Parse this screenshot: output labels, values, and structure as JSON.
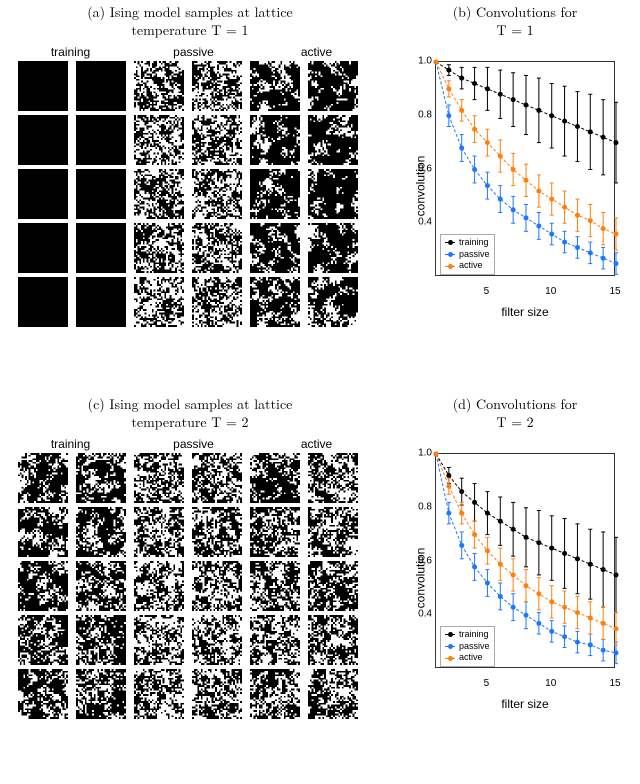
{
  "panels": {
    "a": {
      "caption_prefix": "(a) Ising model samples at lattice",
      "caption_line2": "temperature T = 1",
      "columns": [
        "training",
        "passive",
        "active"
      ]
    },
    "b": {
      "caption_prefix": "(b) Convolutions for",
      "caption_line2": "T = 1"
    },
    "c": {
      "caption_prefix": "(c) Ising model samples at lattice",
      "caption_line2": "temperature T = 2",
      "columns": [
        "training",
        "passive",
        "active"
      ]
    },
    "d": {
      "caption_prefix": "(d) Convolutions for",
      "caption_line2": "T = 2"
    }
  },
  "chart_data": [
    {
      "panel": "b",
      "type": "line",
      "title": "Convolutions for T = 1",
      "xlabel": "filter size",
      "ylabel": "convolution",
      "xlim": [
        1,
        15
      ],
      "ylim": [
        0.2,
        1.0
      ],
      "xticks": [
        5,
        10,
        15
      ],
      "yticks": [
        0.4,
        0.6,
        0.8,
        1.0
      ],
      "x": [
        1,
        2,
        3,
        4,
        5,
        6,
        7,
        8,
        9,
        10,
        11,
        12,
        13,
        14,
        15
      ],
      "series": [
        {
          "name": "training",
          "color": "#000000",
          "values": [
            1.0,
            0.97,
            0.94,
            0.92,
            0.9,
            0.88,
            0.86,
            0.84,
            0.82,
            0.8,
            0.78,
            0.76,
            0.74,
            0.72,
            0.7
          ],
          "err": [
            0,
            0.02,
            0.04,
            0.06,
            0.08,
            0.09,
            0.1,
            0.11,
            0.12,
            0.12,
            0.13,
            0.13,
            0.14,
            0.14,
            0.15
          ]
        },
        {
          "name": "passive",
          "color": "#1f77ff",
          "values": [
            1.0,
            0.8,
            0.68,
            0.6,
            0.54,
            0.49,
            0.45,
            0.42,
            0.39,
            0.36,
            0.33,
            0.31,
            0.29,
            0.27,
            0.25
          ],
          "err": [
            0,
            0.04,
            0.05,
            0.05,
            0.05,
            0.05,
            0.05,
            0.05,
            0.05,
            0.04,
            0.04,
            0.04,
            0.04,
            0.04,
            0.04
          ]
        },
        {
          "name": "active",
          "color": "#ff7f0e",
          "values": [
            1.0,
            0.9,
            0.82,
            0.75,
            0.7,
            0.65,
            0.6,
            0.56,
            0.52,
            0.49,
            0.46,
            0.43,
            0.41,
            0.38,
            0.36
          ],
          "err": [
            0,
            0.03,
            0.04,
            0.05,
            0.05,
            0.06,
            0.06,
            0.06,
            0.06,
            0.06,
            0.06,
            0.06,
            0.06,
            0.06,
            0.06
          ]
        }
      ],
      "legend_position": "lower left"
    },
    {
      "panel": "d",
      "type": "line",
      "title": "Convolutions for T = 2",
      "xlabel": "filter size",
      "ylabel": "convolution",
      "xlim": [
        1,
        15
      ],
      "ylim": [
        0.2,
        1.0
      ],
      "xticks": [
        5,
        10,
        15
      ],
      "yticks": [
        0.4,
        0.6,
        0.8,
        1.0
      ],
      "x": [
        1,
        2,
        3,
        4,
        5,
        6,
        7,
        8,
        9,
        10,
        11,
        12,
        13,
        14,
        15
      ],
      "series": [
        {
          "name": "training",
          "color": "#000000",
          "values": [
            1.0,
            0.92,
            0.86,
            0.82,
            0.78,
            0.75,
            0.72,
            0.69,
            0.67,
            0.65,
            0.63,
            0.61,
            0.59,
            0.57,
            0.55
          ],
          "err": [
            0,
            0.03,
            0.05,
            0.07,
            0.08,
            0.09,
            0.1,
            0.11,
            0.12,
            0.12,
            0.13,
            0.13,
            0.13,
            0.14,
            0.14
          ]
        },
        {
          "name": "passive",
          "color": "#1f77ff",
          "values": [
            1.0,
            0.78,
            0.66,
            0.58,
            0.52,
            0.47,
            0.43,
            0.4,
            0.37,
            0.34,
            0.32,
            0.3,
            0.29,
            0.27,
            0.26
          ],
          "err": [
            0,
            0.04,
            0.05,
            0.05,
            0.05,
            0.05,
            0.05,
            0.05,
            0.04,
            0.04,
            0.04,
            0.04,
            0.04,
            0.04,
            0.04
          ]
        },
        {
          "name": "active",
          "color": "#ff7f0e",
          "values": [
            1.0,
            0.88,
            0.78,
            0.7,
            0.64,
            0.59,
            0.55,
            0.51,
            0.48,
            0.45,
            0.43,
            0.41,
            0.39,
            0.37,
            0.35
          ],
          "err": [
            0,
            0.03,
            0.04,
            0.05,
            0.05,
            0.06,
            0.06,
            0.06,
            0.06,
            0.06,
            0.06,
            0.06,
            0.06,
            0.06,
            0.06
          ]
        }
      ],
      "legend_position": "lower left"
    }
  ],
  "legend": {
    "items": [
      "training",
      "passive",
      "active"
    ]
  }
}
